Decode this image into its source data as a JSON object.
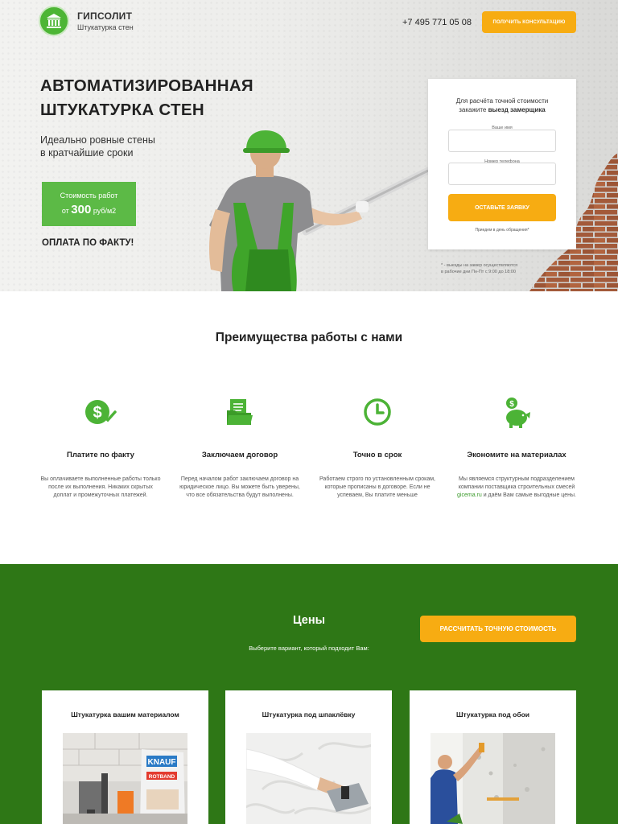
{
  "header": {
    "brand_name": "ГИПСОЛИТ",
    "brand_sub": "Штукатурка стен",
    "phone": "+7 495 771 05 08",
    "consult_button": "ПОЛУЧИТЬ КОНСУЛЬТАЦИЮ"
  },
  "hero": {
    "title": "АВТОМАТИЗИРОВАННАЯ ШТУКАТУРКА СТЕН",
    "subtitle_line1": "Идеально ровные стены",
    "subtitle_line2": "в кратчайшие сроки",
    "price_label": "Стоимость работ",
    "price_prefix": "от",
    "price_value": "300",
    "price_unit": "руб/м2",
    "pay_note": "ОПЛАТА ПО ФАКТУ!"
  },
  "form": {
    "title_line1": "Для расчёта точной стоимости",
    "title_line2_prefix": "закажите",
    "title_line2_bold": "выезд замерщика",
    "name_label": "Ваше имя",
    "phone_label": "Номер телефона",
    "submit_button": "ОСТАВЬТЕ ЗАЯВКУ",
    "note": "Приедем в день обращения*",
    "footnote_line1": "* - выезды на замер осуществляются",
    "footnote_line2": "в рабочие дни Пн-Пт с 9:00 до 18:00"
  },
  "advantages": {
    "title": "Преимущества работы с нами",
    "items": [
      {
        "icon": "dollar-check-icon",
        "heading": "Платите по факту",
        "text": "Вы оплачиваете выполненные работы только после их выполнения. Никаких скрытых доплат и промежуточных платежей."
      },
      {
        "icon": "document-folder-icon",
        "heading": "Заключаем договор",
        "text": "Перед началом работ заключаем договор на юридическое лицо. Вы можете быть уверены, что все обязательства будут выполнены."
      },
      {
        "icon": "clock-icon",
        "heading": "Точно в срок",
        "text": "Работаем строго по установленным срокам, которые прописаны в договоре. Если не успеваем, Вы платите меньше"
      },
      {
        "icon": "piggy-bank-icon",
        "heading": "Экономите на материалах",
        "text_before": "Мы являемся структурным подразделением компании поставщика строительных смесей",
        "link": "gicema.ru",
        "text_after": "и даём Вам самые выгодные цены."
      }
    ]
  },
  "prices": {
    "title": "Цены",
    "subtitle": "Выберите вариант, который подходит Вам:",
    "calc_button": "РАССЧИТАТЬ ТОЧНУЮ СТОИМОСТЬ",
    "cards": [
      {
        "title": "Штукатурка вашим материалом",
        "image": "plaster-bags-tools-image",
        "bag_brand": "KNAUF",
        "bag_product": "ROTBAND"
      },
      {
        "title": "Штукатурка под шпаклёвку",
        "image": "trowel-on-wall-image"
      },
      {
        "title": "Штукатурка под обои",
        "image": "worker-at-wall-image"
      }
    ]
  },
  "colors": {
    "green_accent": "#5cba46",
    "dark_green": "#2e7716",
    "orange": "#f7ac12"
  }
}
